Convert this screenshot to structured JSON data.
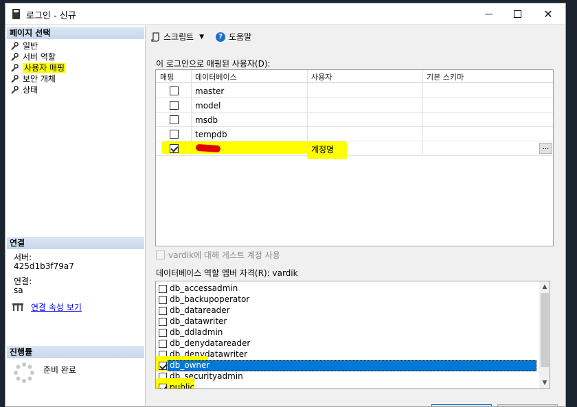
{
  "window": {
    "title": "로그인 - 신규"
  },
  "left": {
    "page_select_header": "페이지 선택",
    "pages": [
      {
        "label": "일반"
      },
      {
        "label": "서버 역할"
      },
      {
        "label": "사용자 매핑"
      },
      {
        "label": "보안 개체"
      },
      {
        "label": "상태"
      }
    ],
    "connection_header": "연결",
    "server_label": "서버:",
    "server_value": "425d1b3f79a7",
    "connection_label": "연결:",
    "connection_value": "sa",
    "view_props_link": "연결 속성 보기",
    "progress_header": "진행률",
    "progress_status": "준비 완료"
  },
  "toolbar": {
    "script_label": "스크립트",
    "help_label": "도움말"
  },
  "mapping": {
    "title": "이 로그인으로 매핑된 사용자(D):",
    "columns": [
      "매핑",
      "데이터베이스",
      "사용자",
      "기본 스키마"
    ],
    "rows": [
      {
        "mapped": false,
        "database": "master",
        "user": "",
        "schema": ""
      },
      {
        "mapped": false,
        "database": "model",
        "user": "",
        "schema": ""
      },
      {
        "mapped": false,
        "database": "msdb",
        "user": "",
        "schema": ""
      },
      {
        "mapped": false,
        "database": "tempdb",
        "user": "",
        "schema": ""
      },
      {
        "mapped": true,
        "database": "",
        "user": "계정명",
        "schema": ""
      }
    ],
    "schema_button": "...",
    "guest_label": "vardik에 대해 게스트 계정 사용"
  },
  "roles": {
    "title": "데이터베이스 역할 멤버 자격(R): vardik",
    "items": [
      {
        "label": "db_accessadmin",
        "checked": false
      },
      {
        "label": "db_backupoperator",
        "checked": false
      },
      {
        "label": "db_datareader",
        "checked": false
      },
      {
        "label": "db_datawriter",
        "checked": false
      },
      {
        "label": "db_ddladmin",
        "checked": false
      },
      {
        "label": "db_denydatareader",
        "checked": false
      },
      {
        "label": "db_denydatawriter",
        "checked": false
      },
      {
        "label": "db_owner",
        "checked": true
      },
      {
        "label": "db_securityadmin",
        "checked": false
      },
      {
        "label": "public",
        "checked": true
      }
    ]
  },
  "colors": {
    "highlight": "#ffff00",
    "selection": "#0078d7",
    "redaction": "#e10000"
  }
}
